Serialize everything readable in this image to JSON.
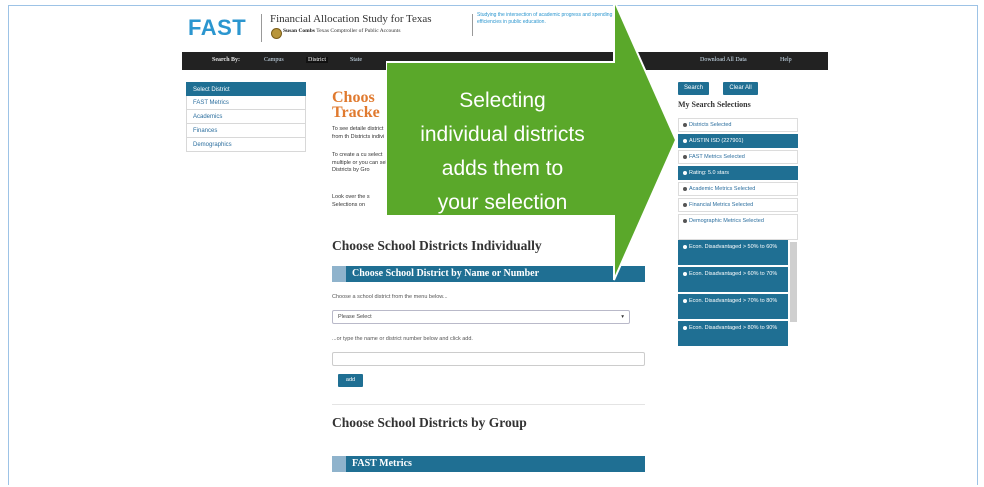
{
  "header": {
    "logo": "FAST",
    "title": "Financial Allocation Study for Texas",
    "subtitle_name": "Susan Combs",
    "subtitle_role": "Texas Comptroller of Public Accounts",
    "tagline": "Studying the intersection of academic progress and spending for efficiencies in public education."
  },
  "nav": {
    "search_by": "Search By:",
    "campus": "Campus",
    "district": "District",
    "state": "State",
    "download": "Download All Data",
    "help": "Help"
  },
  "sidebar": {
    "items": [
      {
        "label": "Select District"
      },
      {
        "label": "FAST Metrics"
      },
      {
        "label": "Academics"
      },
      {
        "label": "Finances"
      },
      {
        "label": "Demographics"
      }
    ]
  },
  "main": {
    "heading_fragment_1": "Choos",
    "heading_fragment_2": "Tracke",
    "para1": "To see detaile district from th Districts indivi",
    "para2": "To create a cu select multiple or you can sele Districts by Gro",
    "para3": "Look over the s Selections on",
    "section1_title": "Choose School Districts Individually",
    "band1_title": "Choose School District by Name or Number",
    "choose_hint": "Choose a school district from the menu below...",
    "select_value": "Please Select",
    "select_caret": "▾",
    "type_hint": "...or type the name or district number below and click add.",
    "add_label": "add",
    "section2_title": "Choose School Districts by Group",
    "band2_title": "FAST Metrics"
  },
  "right_panel": {
    "search_label": "Search",
    "clear_label": "Clear All",
    "title": "My Search Selections",
    "rows": [
      {
        "text": "Districts Selected",
        "highlight": false
      },
      {
        "text": "AUSTIN ISD (227901)",
        "highlight": true
      },
      {
        "text": "FAST Metrics Selected",
        "highlight": false
      },
      {
        "text": "Rating: 5.0 stars",
        "highlight": true
      },
      {
        "text": "Academic Metrics Selected",
        "highlight": false
      },
      {
        "text": "Financial Metrics Selected",
        "highlight": false
      },
      {
        "text": "Demographic Metrics Selected",
        "highlight": false
      },
      {
        "text": "Econ. Disadvantaged > 50% to 60%",
        "highlight": true
      },
      {
        "text": "Econ. Disadvantaged > 60% to 70%",
        "highlight": true
      },
      {
        "text": "Econ. Disadvantaged > 70% to 80%",
        "highlight": true
      },
      {
        "text": "Econ. Disadvantaged > 80% to 90%",
        "highlight": true
      }
    ]
  },
  "callout": {
    "text_line1": "Selecting",
    "text_line2": "individual districts",
    "text_line3": "adds them to",
    "text_line4": "your selection",
    "arrow_color": "#5aa82a"
  },
  "colors": {
    "accent": "#1f6f93",
    "logo": "#2b96cf",
    "heading_orange": "#e07a2f"
  }
}
